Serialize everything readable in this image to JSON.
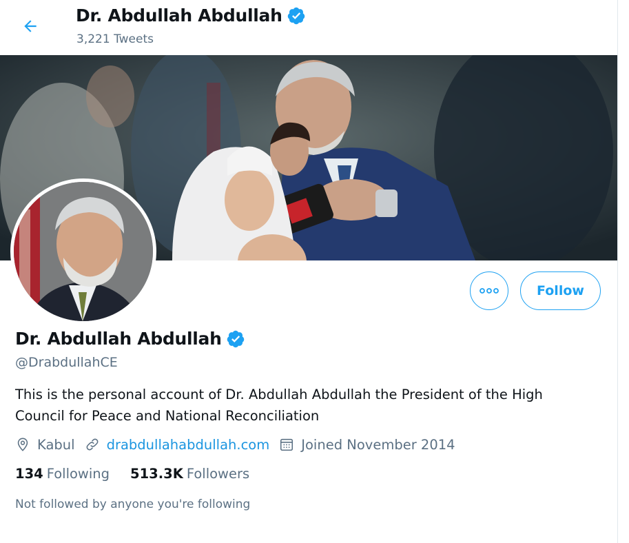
{
  "header": {
    "name": "Dr. Abdullah Abdullah",
    "tweets_count": "3,221 Tweets"
  },
  "icons": {
    "back": "arrow-left-icon",
    "verified": "verified-badge-icon",
    "more": "more-dots-icon",
    "location": "location-pin-icon",
    "link": "link-icon",
    "calendar": "calendar-icon"
  },
  "colors": {
    "accent": "#1da1f2",
    "text_primary": "#0f1419",
    "text_secondary": "#5b7083",
    "link": "#1b95e0"
  },
  "actions": {
    "follow_label": "Follow"
  },
  "profile": {
    "name": "Dr. Abdullah Abdullah",
    "handle": "@DrabdullahCE",
    "bio": "This is the personal account of Dr. Abdullah Abdullah the President of the High Council for Peace and National Reconciliation",
    "location": "Kabul",
    "website": "drabdullahabdullah.com",
    "joined": "Joined November 2014",
    "following_count": "134",
    "following_label": "Following",
    "followers_count": "513.3K",
    "followers_label": "Followers",
    "not_followed_note": "Not followed by anyone you're following"
  }
}
